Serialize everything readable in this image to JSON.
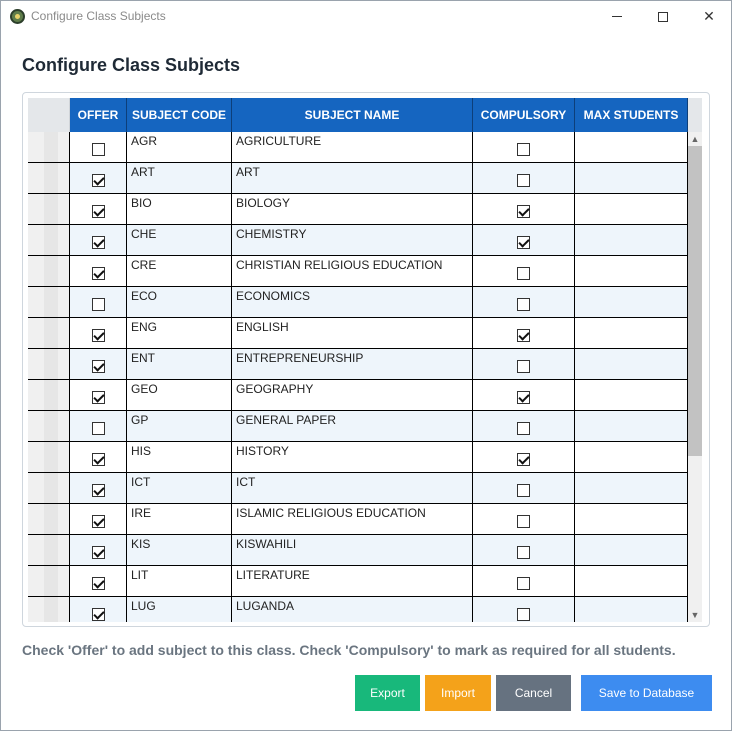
{
  "window": {
    "title": "Configure Class Subjects",
    "minimize_glyph": "",
    "maximize_glyph": "",
    "close_glyph": "✕"
  },
  "heading": "Configure Class Subjects",
  "grid": {
    "columns": [
      "OFFER",
      "SUBJECT CODE",
      "SUBJECT NAME",
      "COMPULSORY",
      "MAX STUDENTS"
    ],
    "rows": [
      {
        "offer": false,
        "code": "AGR",
        "name": "AGRICULTURE",
        "compulsory": false,
        "max": ""
      },
      {
        "offer": true,
        "code": "ART",
        "name": "ART",
        "compulsory": false,
        "max": ""
      },
      {
        "offer": true,
        "code": "BIO",
        "name": "BIOLOGY",
        "compulsory": true,
        "max": ""
      },
      {
        "offer": true,
        "code": "CHE",
        "name": "CHEMISTRY",
        "compulsory": true,
        "max": ""
      },
      {
        "offer": true,
        "code": "CRE",
        "name": "CHRISTIAN RELIGIOUS EDUCATION",
        "compulsory": false,
        "max": ""
      },
      {
        "offer": false,
        "code": "ECO",
        "name": "ECONOMICS",
        "compulsory": false,
        "max": ""
      },
      {
        "offer": true,
        "code": "ENG",
        "name": "ENGLISH",
        "compulsory": true,
        "max": ""
      },
      {
        "offer": true,
        "code": "ENT",
        "name": "ENTREPRENEURSHIP",
        "compulsory": false,
        "max": ""
      },
      {
        "offer": true,
        "code": "GEO",
        "name": "GEOGRAPHY",
        "compulsory": true,
        "max": ""
      },
      {
        "offer": false,
        "code": "GP",
        "name": "GENERAL PAPER",
        "compulsory": false,
        "max": ""
      },
      {
        "offer": true,
        "code": "HIS",
        "name": "HISTORY",
        "compulsory": true,
        "max": ""
      },
      {
        "offer": true,
        "code": "ICT",
        "name": "ICT",
        "compulsory": false,
        "max": ""
      },
      {
        "offer": true,
        "code": "IRE",
        "name": "ISLAMIC RELIGIOUS EDUCATION",
        "compulsory": false,
        "max": ""
      },
      {
        "offer": true,
        "code": "KIS",
        "name": "KISWAHILI",
        "compulsory": false,
        "max": ""
      },
      {
        "offer": true,
        "code": "LIT",
        "name": "LITERATURE",
        "compulsory": false,
        "max": ""
      },
      {
        "offer": true,
        "code": "LUG",
        "name": "LUGANDA",
        "compulsory": false,
        "max": ""
      }
    ]
  },
  "hint": "Check 'Offer' to add subject to this class. Check 'Compulsory' to mark as required for all students.",
  "buttons": {
    "export": "Export",
    "import": "Import",
    "cancel": "Cancel",
    "save": "Save to Database"
  },
  "colors": {
    "header_bg": "#1565c0",
    "export": "#18b87b",
    "import": "#f4a21a",
    "cancel": "#667280",
    "save": "#3d8cf0"
  }
}
